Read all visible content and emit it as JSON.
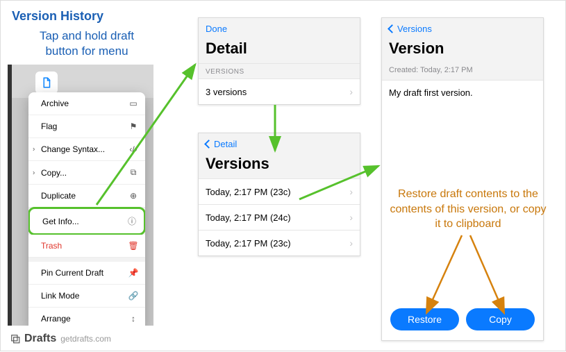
{
  "title": "Version History",
  "subtitle": "Tap and hold draft button for menu",
  "menu": {
    "archive": "Archive",
    "flag": "Flag",
    "change_syntax": "Change Syntax...",
    "copy": "Copy...",
    "duplicate": "Duplicate",
    "get_info": "Get Info...",
    "trash": "Trash",
    "pin": "Pin Current Draft",
    "link_mode": "Link Mode",
    "arrange": "Arrange"
  },
  "detail": {
    "done": "Done",
    "title": "Detail",
    "section": "VERSIONS",
    "versions_row": "3 versions"
  },
  "versions": {
    "back": "Detail",
    "title": "Versions",
    "rows": [
      "Today, 2:17 PM (23c)",
      "Today, 2:17 PM (24c)",
      "Today, 2:17 PM (23c)"
    ]
  },
  "version": {
    "back": "Versions",
    "title": "Version",
    "created": "Created: Today, 2:17 PM",
    "content": "My draft first version.",
    "restore": "Restore",
    "copy": "Copy"
  },
  "annot_restore": "Restore draft contents to the contents of this version, or copy it to clipboard",
  "footer": {
    "brand": "Drafts",
    "url": "getdrafts.com"
  },
  "colors": {
    "green": "#56c12c",
    "orange": "#d6820e"
  }
}
